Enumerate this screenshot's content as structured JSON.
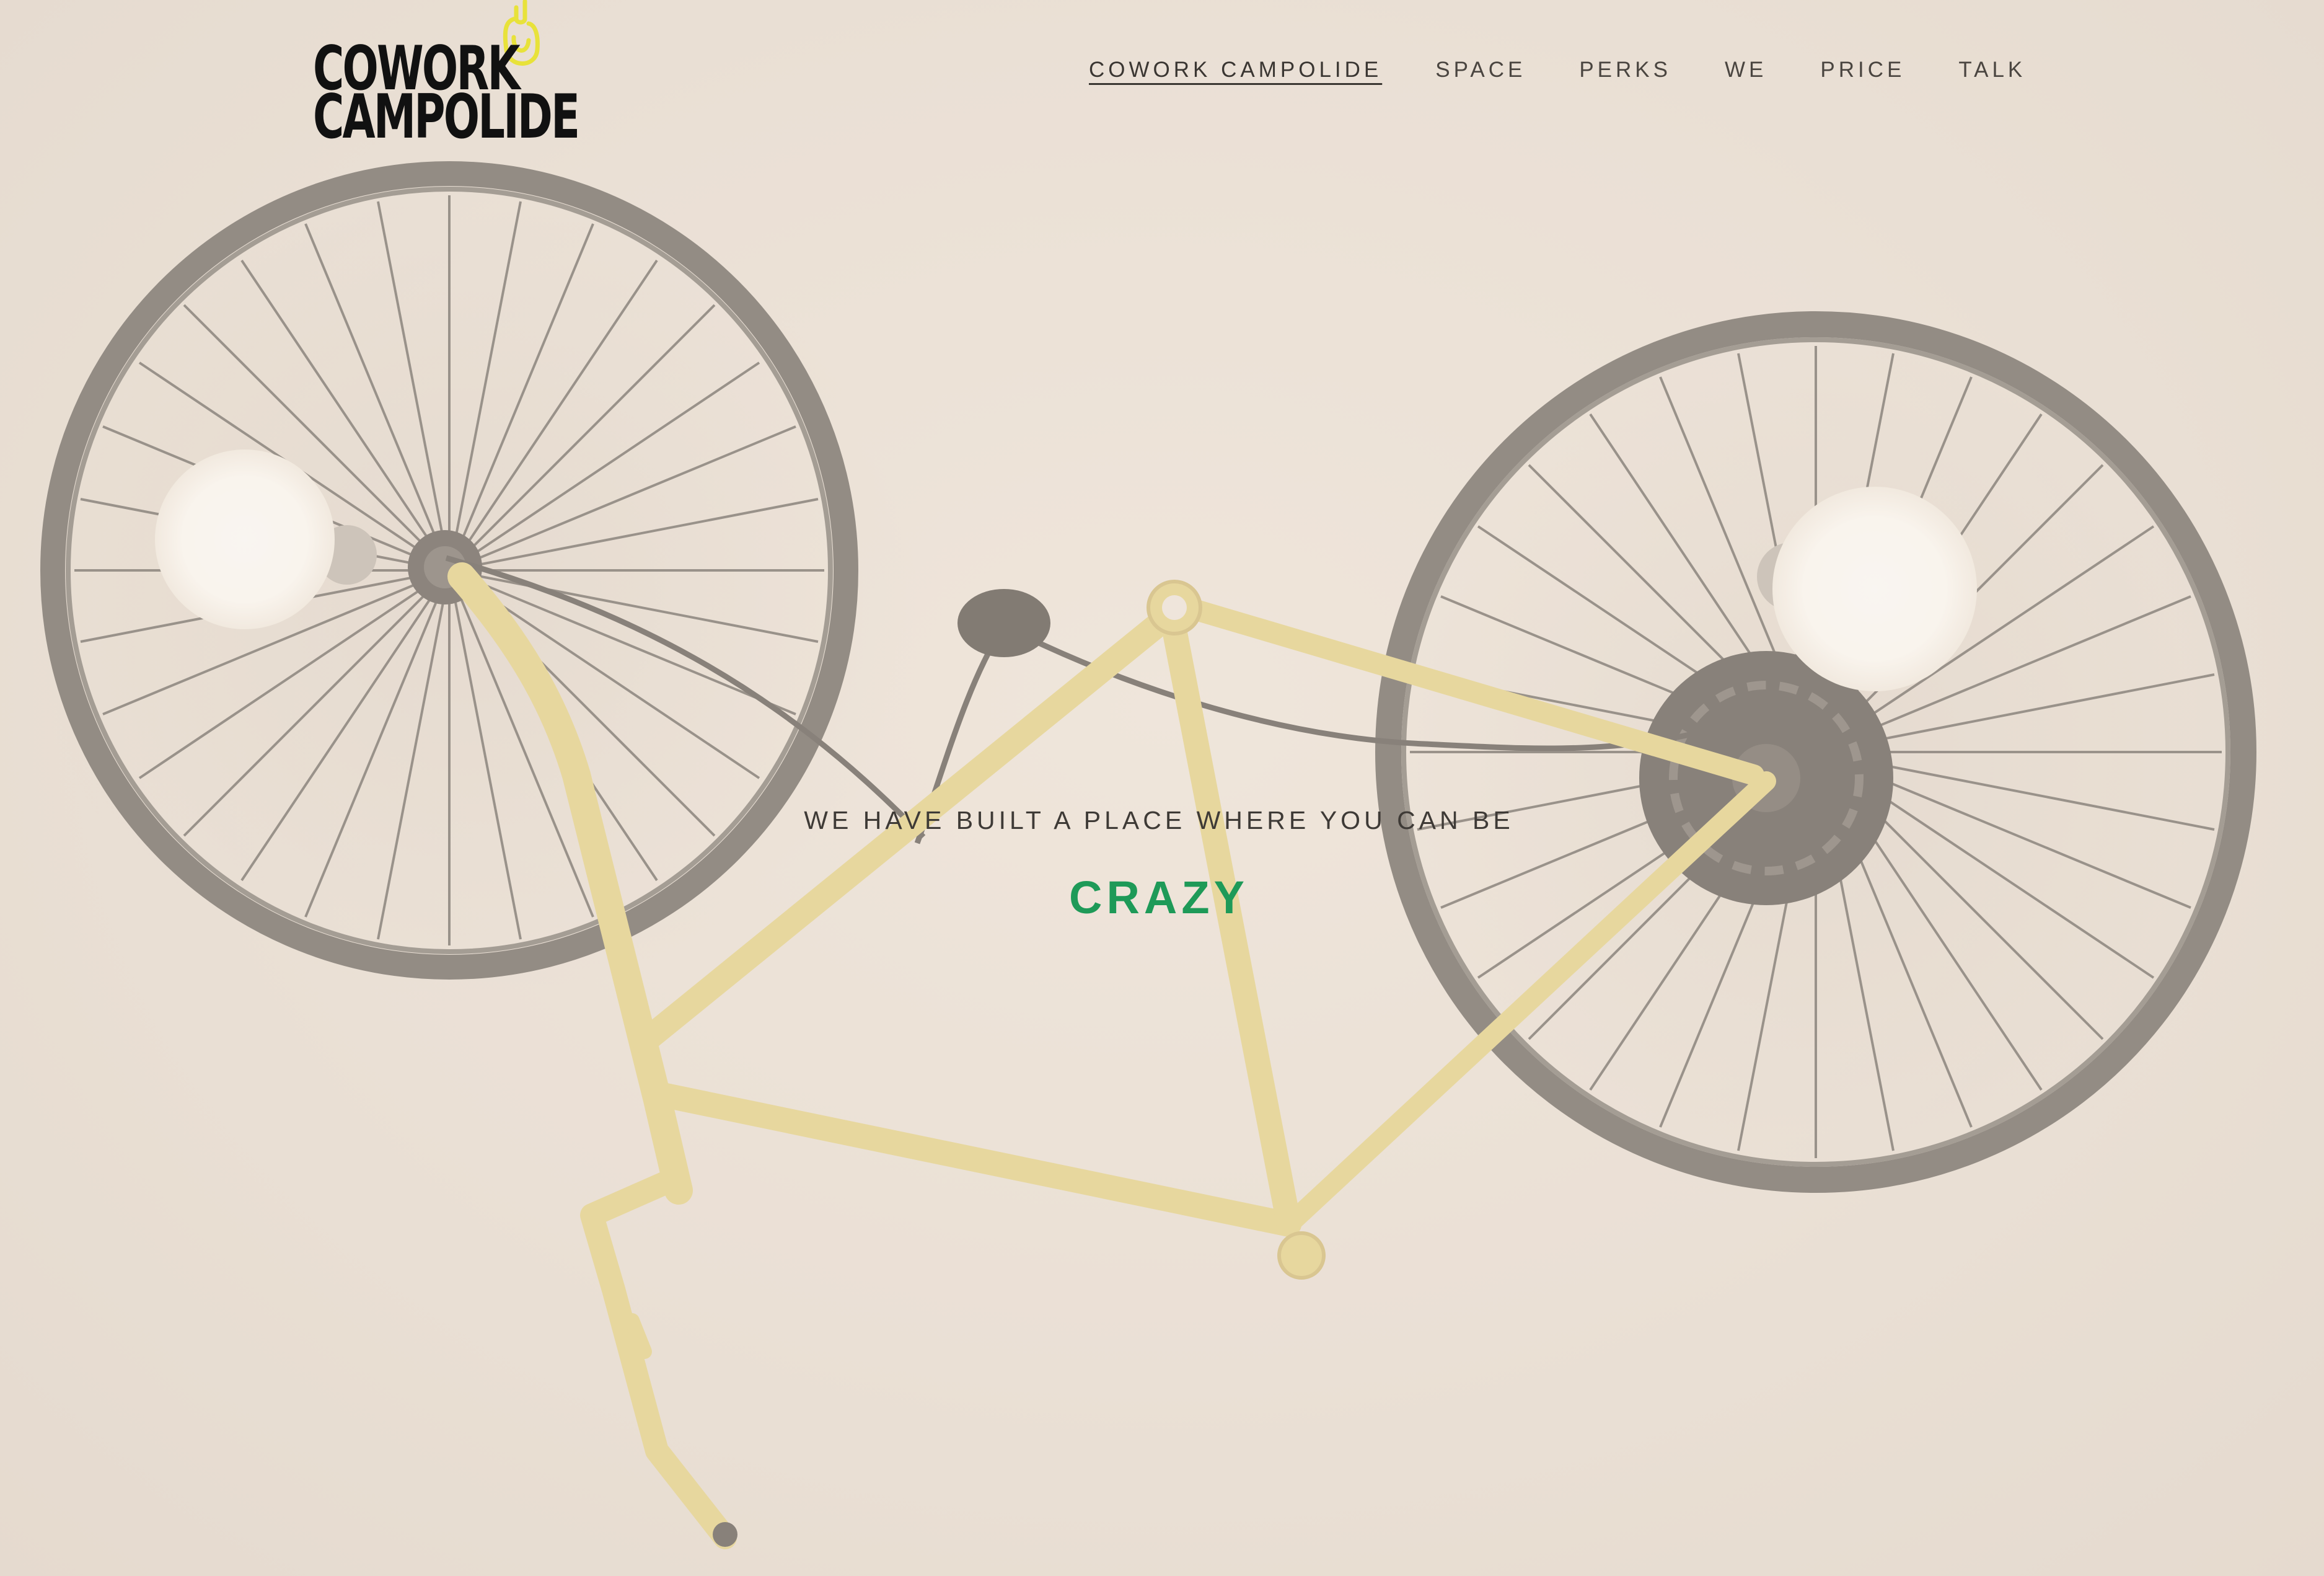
{
  "header": {
    "logo": {
      "line1": "COWORK",
      "line2": "CAMPOLIDE"
    },
    "nav": [
      {
        "label": "COWORK CAMPOLIDE",
        "active": true
      },
      {
        "label": "SPACE",
        "active": false
      },
      {
        "label": "PERKS",
        "active": false
      },
      {
        "label": "WE",
        "active": false
      },
      {
        "label": "PRICE",
        "active": false
      },
      {
        "label": "TALK",
        "active": false
      }
    ]
  },
  "hero": {
    "image": "bicycle-lamp-photo",
    "tagline": "WE HAVE BUILT A PLACE WHERE YOU CAN BE",
    "highlight": "CRAZY"
  },
  "colors": {
    "accent_green": "#1e9a58",
    "logo_clip_yellow": "#e8e23a",
    "text_dark": "#3e3a36",
    "background": "#e6ddd3"
  }
}
